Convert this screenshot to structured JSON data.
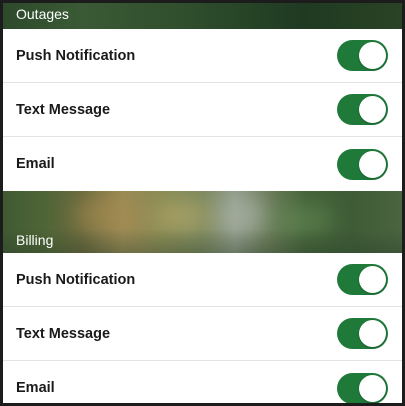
{
  "sections": [
    {
      "title": "Outages",
      "items": [
        {
          "label": "Push Notification",
          "enabled": true
        },
        {
          "label": "Text Message",
          "enabled": true
        },
        {
          "label": "Email",
          "enabled": true
        }
      ]
    },
    {
      "title": "Billing",
      "items": [
        {
          "label": "Push Notification",
          "enabled": true
        },
        {
          "label": "Text Message",
          "enabled": true
        },
        {
          "label": "Email",
          "enabled": true
        }
      ]
    }
  ],
  "colors": {
    "toggle_on": "#1f7a3a",
    "toggle_off": "#e5e5e5",
    "header_text": "#ffffff",
    "row_text": "#1a1a1a"
  }
}
